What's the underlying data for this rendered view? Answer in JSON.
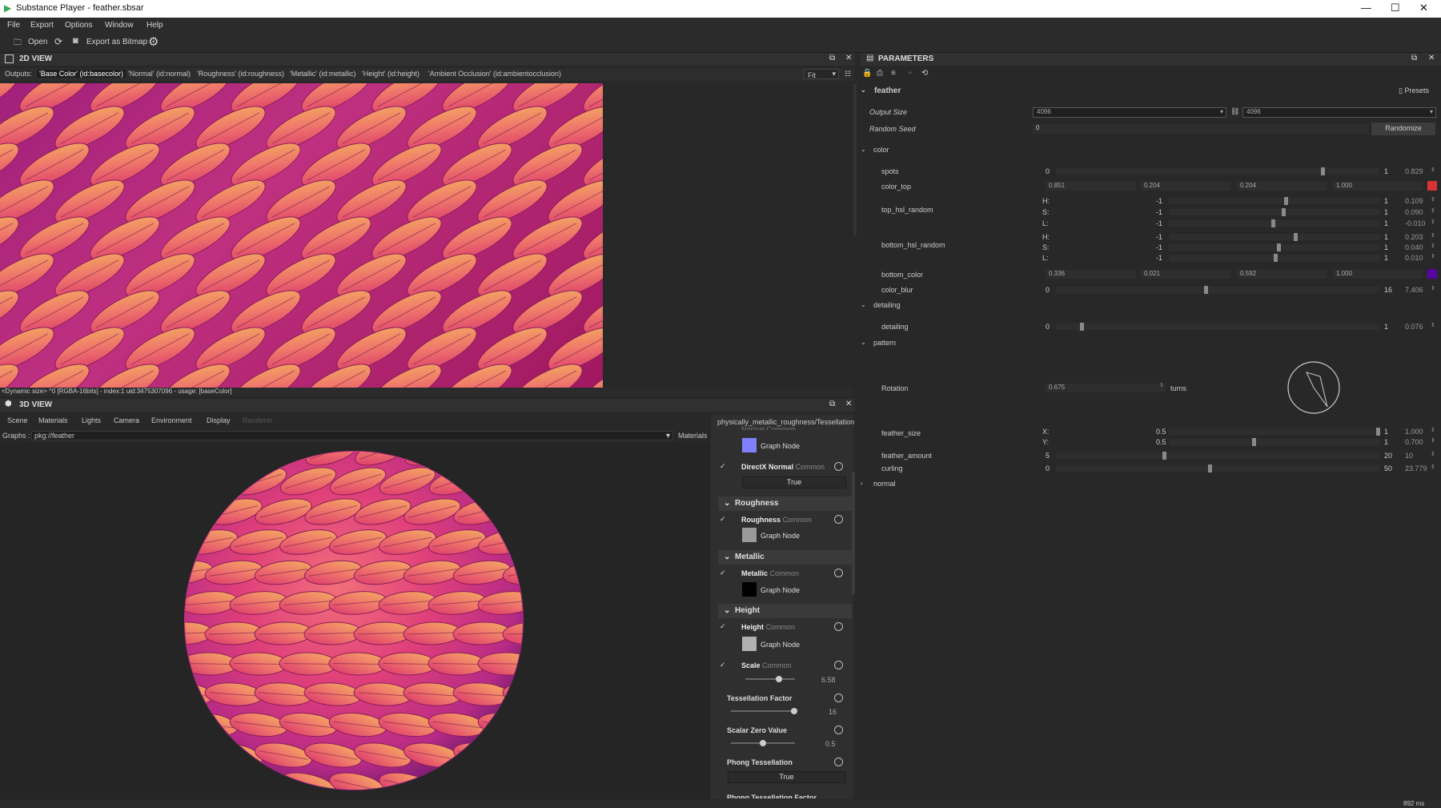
{
  "window": {
    "title": "Substance Player - feather.sbsar"
  },
  "menu": [
    "File",
    "Export",
    "Options",
    "Window",
    "Help"
  ],
  "toolbar": {
    "open": "Open",
    "export_bitmap": "Export as Bitmap"
  },
  "view2d": {
    "title": "2D VIEW",
    "outputs_label": "Outputs:",
    "tabs": [
      "'Base Color' (id:basecolor)",
      "'Normal' (id:normal)",
      "'Roughness' (id:roughness)",
      "'Metallic' (id:metallic)",
      "'Height' (id:height)",
      "'Ambient Occlusion' (id:ambientocclusion)"
    ],
    "zoom": "Fit",
    "status": "<Dynamic size> ^0 [RGBA-16bits] - index:1 uid:3475307096 - usage: [baseColor]"
  },
  "view3d": {
    "title": "3D VIEW",
    "menus": [
      "Scene",
      "Materials",
      "Lights",
      "Camera",
      "Environment",
      "Display",
      "Renderer"
    ],
    "graphs_label": "Graphs :",
    "graphs_value": "pkg://feather",
    "materials_label": "Materials"
  },
  "materials": {
    "path": "physically_metallic_roughness/Tessellation",
    "partial_top": "Normal  Common",
    "graph_node": "Graph Node",
    "common": "Common",
    "true_label": "True",
    "directx": "DirectX Normal",
    "sections": [
      "Roughness",
      "Metallic",
      "Height"
    ],
    "roughness": "Roughness",
    "metallic": "Metallic",
    "height": "Height",
    "scale": {
      "label": "Scale",
      "value": "6.58"
    },
    "tess_factor": {
      "label": "Tessellation Factor",
      "value": "16"
    },
    "scalar_zero": {
      "label": "Scalar Zero Value",
      "value": "0.5"
    },
    "phong": {
      "label": "Phong Tessellation",
      "value": "True"
    },
    "phong_factor": "Phong Tessellation Factor"
  },
  "params": {
    "title": "PARAMETERS",
    "graph": "feather",
    "presets": "Presets",
    "output_size": {
      "label": "Output Size",
      "w": "4096",
      "h": "4096"
    },
    "random_seed": {
      "label": "Random Seed",
      "value": "0",
      "button": "Randomize"
    },
    "groups": {
      "color": "color",
      "detailing": "detailing",
      "pattern": "pattern",
      "normal": "normal"
    },
    "spots": {
      "label": "spots",
      "min": "0",
      "max": "1",
      "value": "0.829",
      "frac": 0.829
    },
    "color_top": {
      "label": "color_top",
      "r": "0.851",
      "g": "0.204",
      "b": "0.204",
      "a": "1.000",
      "swatch": "#d93434"
    },
    "top_hsl": {
      "label": "top_hsl_random",
      "rows": [
        {
          "ch": "H:",
          "min": "-1",
          "max": "1",
          "value": "0.109",
          "frac": 0.5545
        },
        {
          "ch": "S:",
          "min": "-1",
          "max": "1",
          "value": "0.090",
          "frac": 0.545
        },
        {
          "ch": "L:",
          "min": "-1",
          "max": "1",
          "value": "-0.010",
          "frac": 0.495
        }
      ]
    },
    "bottom_hsl": {
      "label": "bottom_hsl_random",
      "rows": [
        {
          "ch": "H:",
          "min": "-1",
          "max": "1",
          "value": "0.203",
          "frac": 0.6015
        },
        {
          "ch": "S:",
          "min": "-1",
          "max": "1",
          "value": "0.040",
          "frac": 0.52
        },
        {
          "ch": "L:",
          "min": "-1",
          "max": "1",
          "value": "0.010",
          "frac": 0.505
        }
      ]
    },
    "bottom_color": {
      "label": "bottom_color",
      "r": "0.336",
      "g": "0.021",
      "b": "0.592",
      "a": "1.000",
      "swatch": "#5605a0"
    },
    "color_blur": {
      "label": "color_blur",
      "min": "0",
      "max": "16",
      "value": "7.406",
      "frac": 0.4629
    },
    "detailing": {
      "label": "detailing",
      "min": "0",
      "max": "1",
      "value": "0.076",
      "frac": 0.076
    },
    "rotation": {
      "label": "Rotation",
      "value": "0.675",
      "unit": "turns"
    },
    "feather_size": {
      "label": "feather_size",
      "rows": [
        {
          "ch": "X:",
          "min": "0.5",
          "max": "1",
          "value": "1.000",
          "frac": 1.0
        },
        {
          "ch": "Y:",
          "min": "0.5",
          "max": "1",
          "value": "0.700",
          "frac": 0.4
        }
      ]
    },
    "feather_amount": {
      "label": "feather_amount",
      "min": "5",
      "max": "20",
      "value": "10",
      "frac": 0.3333
    },
    "curling": {
      "label": "curling",
      "min": "0",
      "max": "50",
      "value": "23.779",
      "frac": 0.4756
    }
  },
  "footer": {
    "timing": "892 ms"
  }
}
